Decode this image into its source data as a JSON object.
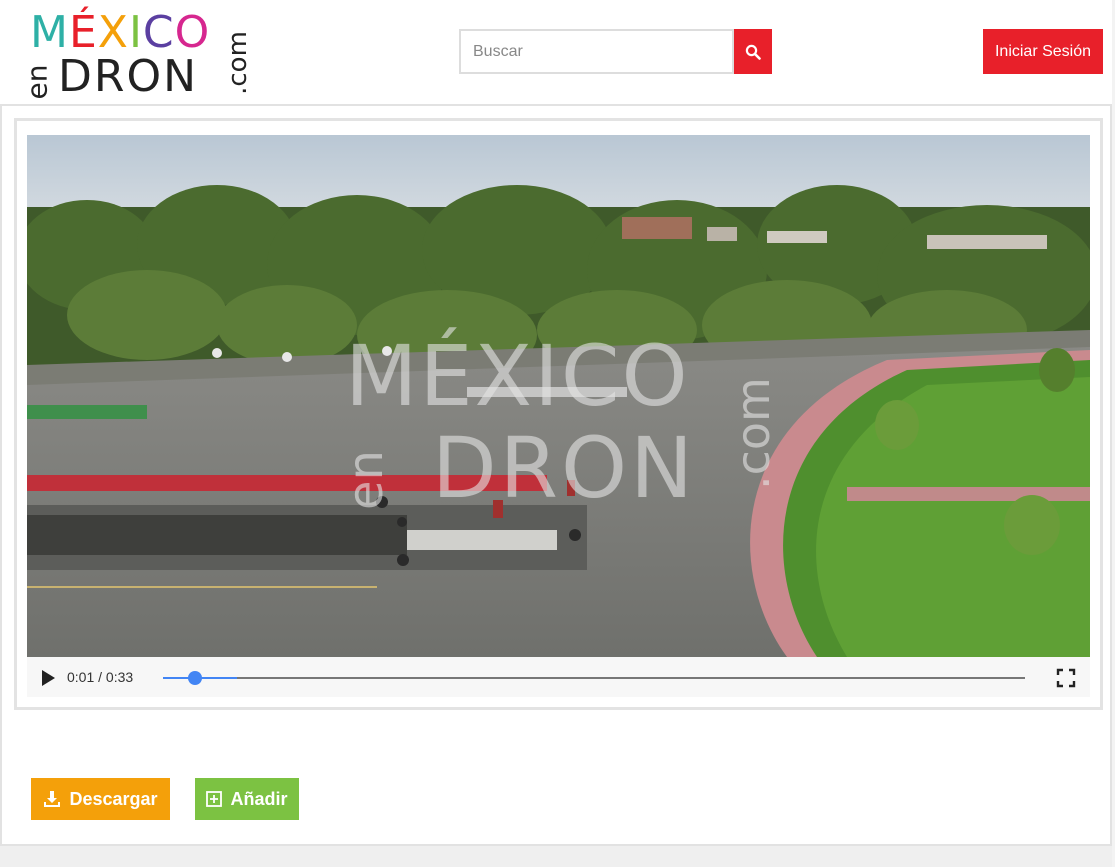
{
  "header": {
    "logo": {
      "line1_letters": [
        {
          "char": "M",
          "color": "#2eb0a6"
        },
        {
          "char": "É",
          "color": "#e8202a"
        },
        {
          "char": "X",
          "color": "#f4a00a"
        },
        {
          "char": "I",
          "color": "#7cc242"
        },
        {
          "char": "C",
          "color": "#5b3fa1"
        },
        {
          "char": "O",
          "color": "#d6278f"
        }
      ],
      "en": "en",
      "line2": "DRON",
      "com": ".com"
    },
    "search": {
      "placeholder": "Buscar",
      "value": "",
      "icon": "search-icon"
    },
    "login_label": "Iniciar Sesión"
  },
  "video": {
    "watermark_top": "MÉXICO",
    "watermark_bottom": "DRON",
    "watermark_en": "en",
    "watermark_com": ".com",
    "current_time": "0:01",
    "duration": "0:33",
    "progress_fraction": 0.03,
    "play_icon": "play-icon",
    "fullscreen_icon": "fullscreen-icon"
  },
  "actions": {
    "download_label": "Descargar",
    "download_icon": "download-icon",
    "add_label": "Añadir",
    "add_icon": "plus-square-icon"
  },
  "colors": {
    "brand_red": "#e8202a",
    "download_orange": "#f4a00a",
    "add_green": "#7cc242",
    "seek_blue": "#4285f4"
  }
}
